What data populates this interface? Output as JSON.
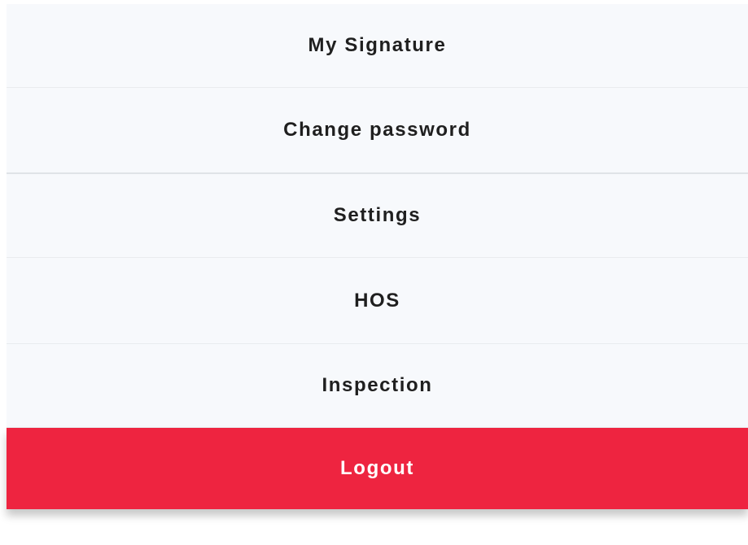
{
  "menu": {
    "items": [
      {
        "label": "My Signature"
      },
      {
        "label": "Change password"
      },
      {
        "label": "Settings"
      },
      {
        "label": "HOS"
      },
      {
        "label": "Inspection"
      }
    ],
    "logout": {
      "label": "Logout"
    }
  },
  "colors": {
    "item_background": "#f7f9fc",
    "item_text": "#1f1f1f",
    "divider": "#e9ecef",
    "logout_background": "#ee2440",
    "logout_text": "#ffffff"
  }
}
